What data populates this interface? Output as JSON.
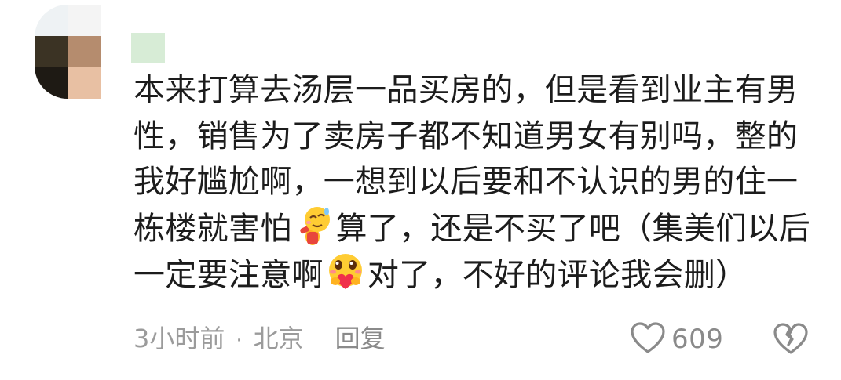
{
  "comment": {
    "lines": [
      "本来打算去汤层一品买房的，但是看到业主有男",
      "性，销售为了卖房子都不知道男女有别吗，整的",
      "我好尴尬啊，一想到以后要和不认识的男的住一",
      {
        "before": "栋楼就害怕",
        "emoji": "nervous-bow-emoji",
        "after": "算了，还是不买了吧（集美们以后"
      },
      {
        "before": "一定要注意啊",
        "emoji": "heart-hug-emoji",
        "after": "对了，不好的评论我会删）"
      }
    ],
    "line1": "本来打算去汤层一品买房的，但是看到业主有男",
    "line2": "性，销售为了卖房子都不知道男女有别吗，整的",
    "line3": "我好尴尬啊，一想到以后要和不认识的男的住一",
    "line4_before": "栋楼就害怕",
    "line4_after": "算了，还是不买了吧（集美们以后",
    "line5_before": "一定要注意啊",
    "line5_after": "对了，不好的评论我会删）"
  },
  "meta": {
    "time": "3小时前",
    "separator": "·",
    "location": "北京",
    "reply_label": "回复"
  },
  "actions": {
    "like_icon": "heart-outline-icon",
    "like_count": "609",
    "dislike_icon": "broken-heart-icon"
  },
  "colors": {
    "text": "#1c1c1c",
    "meta": "#9b9b9b",
    "icon": "#8a8a8a",
    "username_placeholder": "#d7ecd6"
  }
}
